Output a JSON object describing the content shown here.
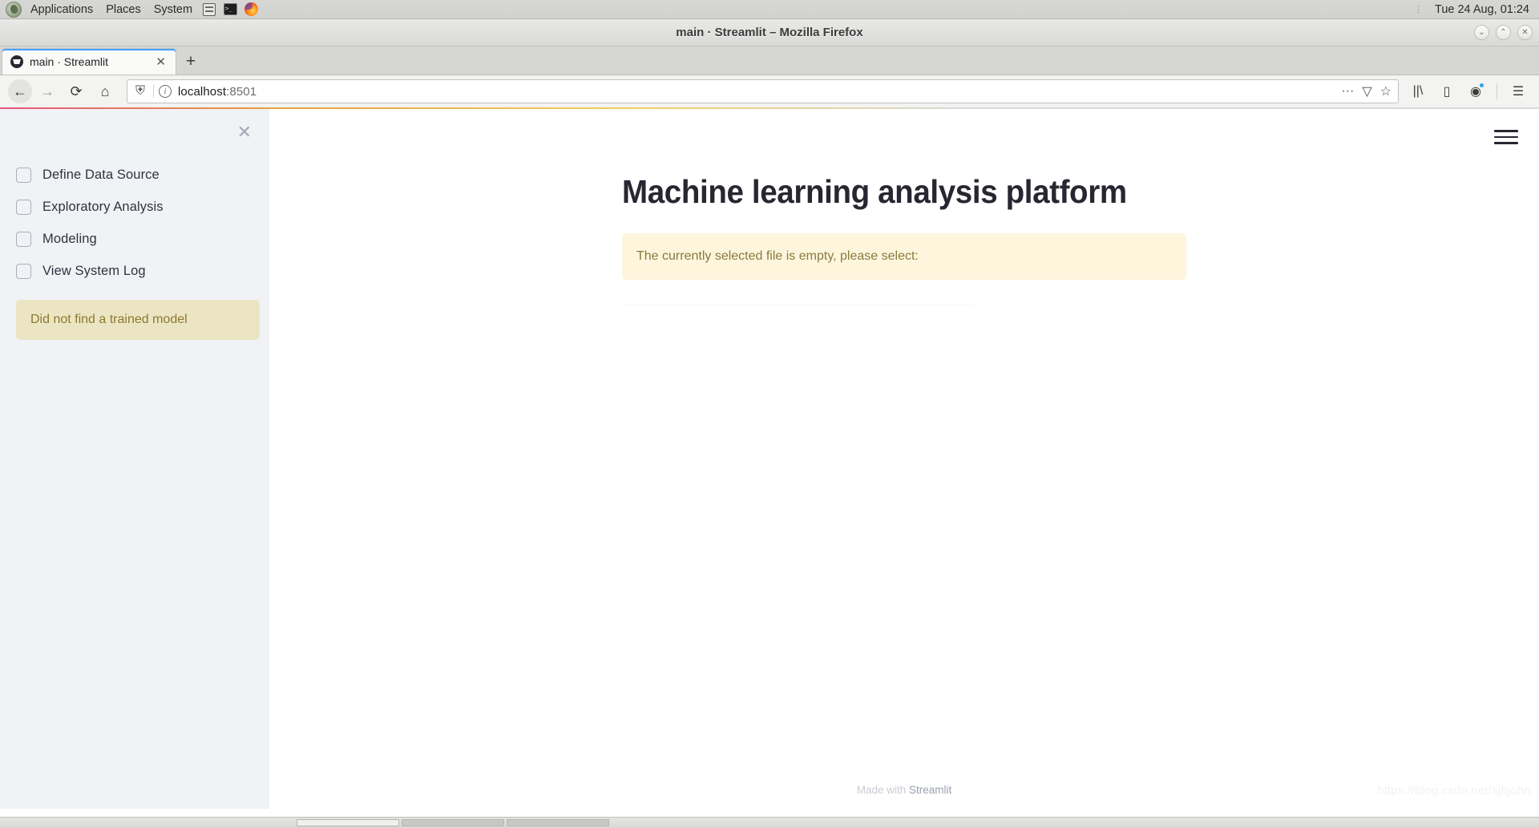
{
  "desktop": {
    "menus": [
      "Applications",
      "Places",
      "System"
    ],
    "launchers": [
      "file-manager-icon",
      "terminal-icon",
      "firefox-icon"
    ],
    "clock": "Tue 24 Aug, 01:24",
    "grip": "⋮"
  },
  "window": {
    "title": "main · Streamlit – Mozilla Firefox",
    "controls": [
      {
        "name": "minimize-button",
        "glyph": "⌄"
      },
      {
        "name": "maximize-button",
        "glyph": "⌃"
      },
      {
        "name": "close-button",
        "glyph": "✕"
      }
    ]
  },
  "browser": {
    "tab": {
      "title": "main · Streamlit",
      "close_glyph": "✕"
    },
    "new_tab_glyph": "+",
    "nav": {
      "back_glyph": "←",
      "forward_glyph": "→",
      "reload_glyph": "⟳",
      "home_glyph": "⌂"
    },
    "url": {
      "host": "localhost",
      "port": ":8501",
      "shield_glyph": "⛨",
      "info_glyph": "i",
      "page_actions_glyph": "···",
      "pocket_glyph": "▽",
      "bookmark_glyph": "☆"
    },
    "toolbar": {
      "library_glyph": "||\\",
      "sidebar_glyph": "▯",
      "account_glyph": "◉",
      "menu_glyph": "☰"
    }
  },
  "sidebar": {
    "close_glyph": "✕",
    "checkboxes": [
      {
        "label": "Define Data Source",
        "checked": false
      },
      {
        "label": "Exploratory Analysis",
        "checked": false
      },
      {
        "label": "Modeling",
        "checked": false
      },
      {
        "label": "View System Log",
        "checked": false
      }
    ],
    "warning": "Did not find a trained model",
    "warning_bg": "#ece5c4",
    "warning_fg": "#8a7a2e",
    "background": "#f0f2f6"
  },
  "main": {
    "title": "Machine learning analysis platform",
    "warning": "The currently selected file is empty, please select:",
    "warning_bg": "#fdf6dd",
    "warning_fg": "#8a7a3e",
    "hamburger_glyph": "☰",
    "title_color": "#262730"
  },
  "footer": {
    "prefix": "Made with ",
    "link": "Streamlit"
  },
  "watermark": "https://blog.csdn.net/sjhjohn"
}
